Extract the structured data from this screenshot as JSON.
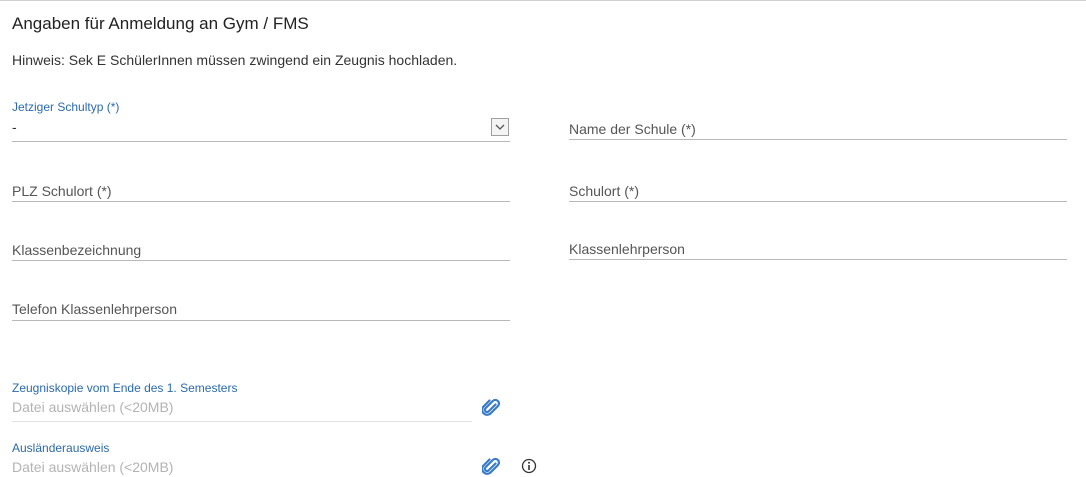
{
  "section": {
    "title": "Angaben für Anmeldung an Gym / FMS",
    "hint": "Hinweis: Sek E SchülerInnen müssen zwingend ein Zeugnis hochladen."
  },
  "schultyp": {
    "label": "Jetziger Schultyp (*)",
    "value": "-"
  },
  "fields": {
    "name_schule": "Name der Schule (*)",
    "plz": "PLZ Schulort (*)",
    "schulort": "Schulort (*)",
    "klasse": "Klassenbezeichnung",
    "klassenlehrperson": "Klassenlehrperson",
    "telefon": "Telefon Klassenlehrperson"
  },
  "uploads": {
    "zeugnis_label": "Zeugniskopie vom Ende des 1. Semesters",
    "zeugnis_placeholder": "Datei auswählen (<20MB)",
    "ausweis_label": "Ausländerausweis",
    "ausweis_placeholder": "Datei auswählen (<20MB)"
  },
  "colors": {
    "label_blue": "#2a6aad",
    "clip_blue": "#3a7bc8"
  }
}
